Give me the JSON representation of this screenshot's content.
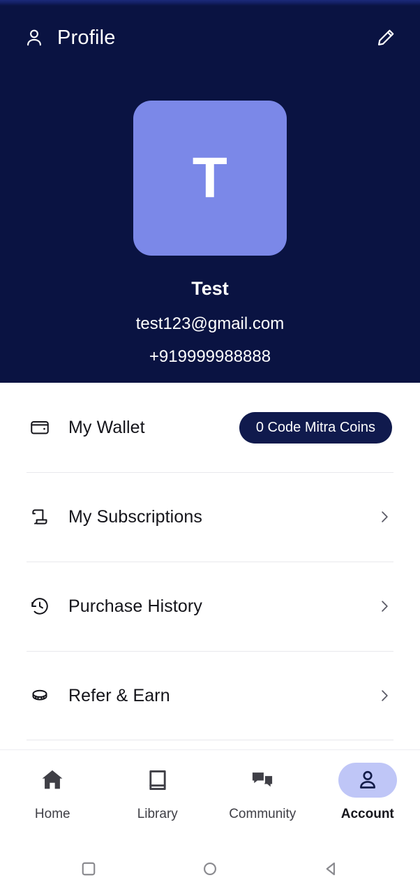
{
  "status_bar": {
    "accent_color": "#111d5e"
  },
  "header": {
    "title": "Profile",
    "person_icon": "person-outline-icon",
    "edit_icon": "pencil-icon",
    "background_color": "#0a1342"
  },
  "profile": {
    "avatar_letter": "T",
    "avatar_color": "#7b88e8",
    "name": "Test",
    "email": "test123@gmail.com",
    "phone": "+919999988888"
  },
  "menu": {
    "items": [
      {
        "label": "My Wallet",
        "icon": "wallet-icon",
        "badge": "0 Code Mitra Coins",
        "badge_color": "#101a4d",
        "has_chevron": false
      },
      {
        "label": "My Subscriptions",
        "icon": "scroll-icon",
        "badge": null,
        "has_chevron": true
      },
      {
        "label": "Purchase History",
        "icon": "history-clock-icon",
        "badge": null,
        "has_chevron": true
      },
      {
        "label": "Refer & Earn",
        "icon": "coin-icon",
        "badge": null,
        "has_chevron": true
      }
    ]
  },
  "tab_bar": {
    "active_color": "#bfc6f7",
    "tabs": [
      {
        "label": "Home",
        "icon": "home-icon",
        "active": false
      },
      {
        "label": "Library",
        "icon": "book-icon",
        "active": false
      },
      {
        "label": "Community",
        "icon": "chat-bubbles-icon",
        "active": false
      },
      {
        "label": "Account",
        "icon": "account-person-icon",
        "active": true
      }
    ]
  },
  "system_nav": {
    "buttons": [
      {
        "name": "recents-square-icon"
      },
      {
        "name": "home-circle-icon"
      },
      {
        "name": "back-triangle-icon"
      }
    ]
  }
}
